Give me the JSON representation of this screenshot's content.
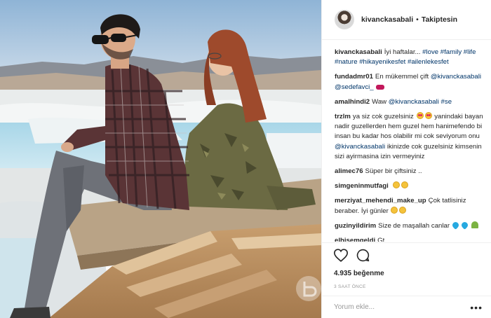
{
  "post": {
    "username": "kivanckasabali",
    "separator": "•",
    "follow_status": "Takiptesin"
  },
  "caption": {
    "user": "kivanckasabali",
    "text": "İyi haftalar...",
    "tags": "#love #family #life #nature #hikayenikesfet #ailenlekesfet"
  },
  "comments": [
    {
      "user": "fundadmr01",
      "text": "En mükemmel çift",
      "tags": "@kivanckasabali @sedefavci_",
      "emoji_after": [
        "heart-red"
      ]
    },
    {
      "user": "amalhindi2",
      "text": "Waw",
      "tags": "@kivanckasabali #se",
      "emoji_after": []
    },
    {
      "user": "trzlm",
      "text": "ya siz cok guzelsiniz",
      "text2": "yanindaki bayan nadir guzellerden hem guzel hem hanimefendo bi insan bu kadar hos olabilir mi cok seviyorum onu",
      "mention": "@kivanckasabali",
      "text3": "ikinizde cok guzelsiniz kimsenin sizi ayirmasina izin vermeyiniz",
      "emoji_mid": [
        "love",
        "love"
      ]
    },
    {
      "user": "alimec76",
      "text": "Süper bir çiftsiniz ..",
      "emoji_after": []
    },
    {
      "user": "simgeninmutfagi",
      "text": "",
      "emoji_after": [
        "yellow",
        "yellow"
      ]
    },
    {
      "user": "merziyat_mehendi_make_up",
      "text": "Çok tatlisiniz beraber. İyi günler",
      "emoji_after": [
        "yellow",
        "yellow"
      ]
    },
    {
      "user": "guzinyildirim",
      "text": "Size de maşallah canlar",
      "emoji_after": [
        "heart-blue",
        "heart-blue",
        "plant"
      ]
    },
    {
      "user": "elhisemgeldi",
      "text": "Gt",
      "emoji_after": []
    }
  ],
  "actions": {
    "like_icon": "heart-outline-icon",
    "comment_icon": "comment-bubble-icon",
    "likes_count": "4.935",
    "likes_label": "beğenme",
    "time": "3 SAAT ÖNCE"
  },
  "add_comment": {
    "placeholder": "Yorum ekle...",
    "more": "•••"
  },
  "colors": {
    "link": "#003569",
    "text": "#262626",
    "muted": "#999999",
    "border": "#efefef"
  }
}
